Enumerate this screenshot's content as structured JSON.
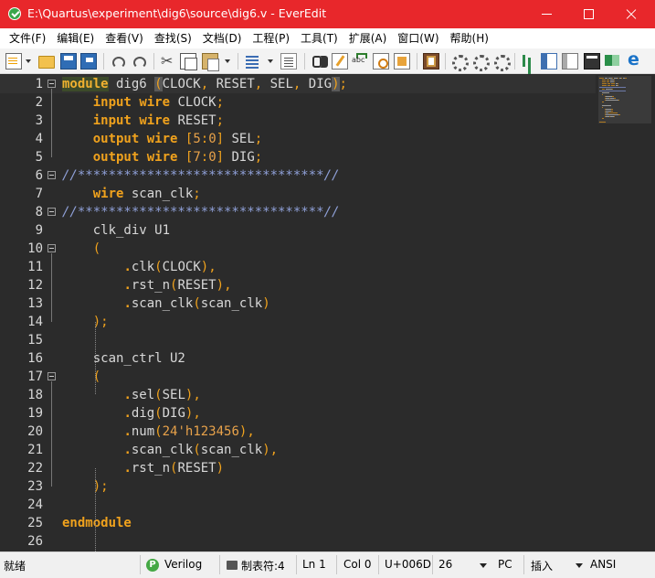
{
  "window": {
    "title": "E:\\Quartus\\experiment\\dig6\\source\\dig6.v - EverEdit"
  },
  "menu": [
    "文件(F)",
    "编辑(E)",
    "查看(V)",
    "查找(S)",
    "文档(D)",
    "工程(P)",
    "工具(T)",
    "扩展(A)",
    "窗口(W)",
    "帮助(H)"
  ],
  "code_lines": [
    [
      [
        "module",
        "kw"
      ],
      [
        " dig6 ",
        "id"
      ],
      [
        "(",
        "p"
      ],
      [
        "CLOCK",
        "id"
      ],
      [
        ",",
        "p"
      ],
      [
        " RESET",
        "id"
      ],
      [
        ",",
        "p"
      ],
      [
        " SEL",
        "id"
      ],
      [
        ",",
        "p"
      ],
      [
        " DIG",
        "id"
      ],
      [
        ")",
        "p"
      ],
      [
        ";",
        "p"
      ]
    ],
    [
      [
        "    ",
        "id"
      ],
      [
        "input",
        "kw"
      ],
      [
        " ",
        "id"
      ],
      [
        "wire",
        "kw"
      ],
      [
        " CLOCK",
        "id"
      ],
      [
        ";",
        "p"
      ]
    ],
    [
      [
        "    ",
        "id"
      ],
      [
        "input",
        "kw"
      ],
      [
        " ",
        "id"
      ],
      [
        "wire",
        "kw"
      ],
      [
        " RESET",
        "id"
      ],
      [
        ";",
        "p"
      ]
    ],
    [
      [
        "    ",
        "id"
      ],
      [
        "output",
        "kw"
      ],
      [
        " ",
        "id"
      ],
      [
        "wire",
        "kw"
      ],
      [
        " ",
        "id"
      ],
      [
        "[",
        "p"
      ],
      [
        "5",
        "num"
      ],
      [
        ":",
        "p"
      ],
      [
        "0",
        "num"
      ],
      [
        "]",
        "p"
      ],
      [
        " SEL",
        "id"
      ],
      [
        ";",
        "p"
      ]
    ],
    [
      [
        "    ",
        "id"
      ],
      [
        "output",
        "kw"
      ],
      [
        " ",
        "id"
      ],
      [
        "wire",
        "kw"
      ],
      [
        " ",
        "id"
      ],
      [
        "[",
        "p"
      ],
      [
        "7",
        "num"
      ],
      [
        ":",
        "p"
      ],
      [
        "0",
        "num"
      ],
      [
        "]",
        "p"
      ],
      [
        " DIG",
        "id"
      ],
      [
        ";",
        "p"
      ]
    ],
    [
      [
        "//********************************//",
        "com"
      ]
    ],
    [
      [
        "    ",
        "id"
      ],
      [
        "wire",
        "kw"
      ],
      [
        " scan_clk",
        "id"
      ],
      [
        ";",
        "p"
      ]
    ],
    [
      [
        "//********************************//",
        "com"
      ]
    ],
    [
      [
        "    clk_div U1",
        "id"
      ]
    ],
    [
      [
        "    ",
        "id"
      ],
      [
        "(",
        "p"
      ]
    ],
    [
      [
        "        ",
        "id"
      ],
      [
        ".",
        "dot"
      ],
      [
        "clk",
        "id"
      ],
      [
        "(",
        "p"
      ],
      [
        "CLOCK",
        "id"
      ],
      [
        ")",
        "p"
      ],
      [
        ",",
        "p"
      ]
    ],
    [
      [
        "        ",
        "id"
      ],
      [
        ".",
        "dot"
      ],
      [
        "rst_n",
        "id"
      ],
      [
        "(",
        "p"
      ],
      [
        "RESET",
        "id"
      ],
      [
        ")",
        "p"
      ],
      [
        ",",
        "p"
      ]
    ],
    [
      [
        "        ",
        "id"
      ],
      [
        ".",
        "dot"
      ],
      [
        "scan_clk",
        "id"
      ],
      [
        "(",
        "p"
      ],
      [
        "scan_clk",
        "id"
      ],
      [
        ")",
        "p"
      ]
    ],
    [
      [
        "    ",
        "id"
      ],
      [
        ")",
        "p"
      ],
      [
        ";",
        "p"
      ]
    ],
    [
      [
        "",
        "id"
      ]
    ],
    [
      [
        "    scan_ctrl U2",
        "id"
      ]
    ],
    [
      [
        "    ",
        "id"
      ],
      [
        "(",
        "p"
      ]
    ],
    [
      [
        "        ",
        "id"
      ],
      [
        ".",
        "dot"
      ],
      [
        "sel",
        "id"
      ],
      [
        "(",
        "p"
      ],
      [
        "SEL",
        "id"
      ],
      [
        ")",
        "p"
      ],
      [
        ",",
        "p"
      ]
    ],
    [
      [
        "        ",
        "id"
      ],
      [
        ".",
        "dot"
      ],
      [
        "dig",
        "id"
      ],
      [
        "(",
        "p"
      ],
      [
        "DIG",
        "id"
      ],
      [
        ")",
        "p"
      ],
      [
        ",",
        "p"
      ]
    ],
    [
      [
        "        ",
        "id"
      ],
      [
        ".",
        "dot"
      ],
      [
        "num",
        "id"
      ],
      [
        "(",
        "p"
      ],
      [
        "24'h123456",
        "num"
      ],
      [
        ")",
        "p"
      ],
      [
        ",",
        "p"
      ]
    ],
    [
      [
        "        ",
        "id"
      ],
      [
        ".",
        "dot"
      ],
      [
        "scan_clk",
        "id"
      ],
      [
        "(",
        "p"
      ],
      [
        "scan_clk",
        "id"
      ],
      [
        ")",
        "p"
      ],
      [
        ",",
        "p"
      ]
    ],
    [
      [
        "        ",
        "id"
      ],
      [
        ".",
        "dot"
      ],
      [
        "rst_n",
        "id"
      ],
      [
        "(",
        "p"
      ],
      [
        "RESET",
        "id"
      ],
      [
        ")",
        "p"
      ]
    ],
    [
      [
        "    ",
        "id"
      ],
      [
        ")",
        "p"
      ],
      [
        ";",
        "p"
      ]
    ],
    [
      [
        "",
        "id"
      ]
    ],
    [
      [
        "endmodule",
        "kw"
      ]
    ],
    [
      [
        "",
        "id"
      ]
    ]
  ],
  "folds": [
    1,
    6,
    8,
    10,
    17
  ],
  "status": {
    "ready": "就绪",
    "language": "Verilog",
    "lang_letter": "P",
    "tab": "制表符:4",
    "line": "Ln 1",
    "col": "Col 0",
    "unicode": "U+006D",
    "total_lines": "26",
    "line_ending": "PC",
    "insert_mode": "插入",
    "encoding": "ANSI"
  },
  "colors": {
    "keyword": "#f0a21d",
    "editor_bg": "#2b2b2b",
    "titlebar": "#e8272b"
  }
}
